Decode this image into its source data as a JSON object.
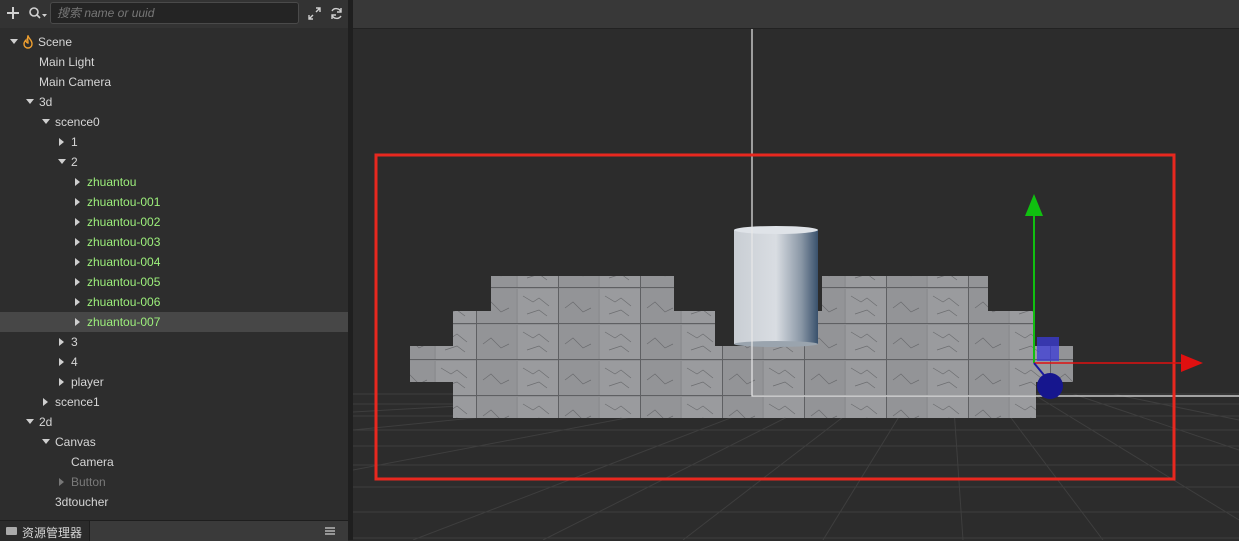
{
  "hierarchy": {
    "search_placeholder": "搜索 name or uuid",
    "icons": {
      "add": "plus-icon",
      "search": "search-dropdown-icon",
      "expand": "expand-icon",
      "refresh": "refresh-icon"
    },
    "nodes": [
      {
        "label": "Scene",
        "depth": 0,
        "arrow": "down",
        "icon": "scene-flame-icon"
      },
      {
        "label": "Main Light",
        "depth": 1,
        "arrow": "none"
      },
      {
        "label": "Main Camera",
        "depth": 1,
        "arrow": "none"
      },
      {
        "label": "3d",
        "depth": 1,
        "arrow": "down"
      },
      {
        "label": "scence0",
        "depth": 2,
        "arrow": "down"
      },
      {
        "label": "1",
        "depth": 3,
        "arrow": "right"
      },
      {
        "label": "2",
        "depth": 3,
        "arrow": "down"
      },
      {
        "label": "zhuantou",
        "depth": 4,
        "arrow": "right",
        "style": "prefab"
      },
      {
        "label": "zhuantou-001",
        "depth": 4,
        "arrow": "right",
        "style": "prefab"
      },
      {
        "label": "zhuantou-002",
        "depth": 4,
        "arrow": "right",
        "style": "prefab"
      },
      {
        "label": "zhuantou-003",
        "depth": 4,
        "arrow": "right",
        "style": "prefab"
      },
      {
        "label": "zhuantou-004",
        "depth": 4,
        "arrow": "right",
        "style": "prefab"
      },
      {
        "label": "zhuantou-005",
        "depth": 4,
        "arrow": "right",
        "style": "prefab"
      },
      {
        "label": "zhuantou-006",
        "depth": 4,
        "arrow": "right",
        "style": "prefab"
      },
      {
        "label": "zhuantou-007",
        "depth": 4,
        "arrow": "right",
        "style": "prefab",
        "selected": true
      },
      {
        "label": "3",
        "depth": 3,
        "arrow": "right"
      },
      {
        "label": "4",
        "depth": 3,
        "arrow": "right"
      },
      {
        "label": "player",
        "depth": 3,
        "arrow": "right"
      },
      {
        "label": "scence1",
        "depth": 2,
        "arrow": "right"
      },
      {
        "label": "2d",
        "depth": 1,
        "arrow": "down"
      },
      {
        "label": "Canvas",
        "depth": 2,
        "arrow": "down"
      },
      {
        "label": "Camera",
        "depth": 3,
        "arrow": "none"
      },
      {
        "label": "Button",
        "depth": 3,
        "arrow": "right",
        "style": "disabled"
      },
      {
        "label": "3dtoucher",
        "depth": 2,
        "arrow": "none"
      }
    ]
  },
  "assets_panel": {
    "tab_label": "资源管理器",
    "icon": "folder-icon",
    "menu_icon": "menu-icon"
  },
  "colors": {
    "prefab": "#9df07c",
    "selection_box": "#e8281f",
    "axis_x": "#e01010",
    "axis_y": "#10c010",
    "axis_z": "#1a1aa0"
  }
}
